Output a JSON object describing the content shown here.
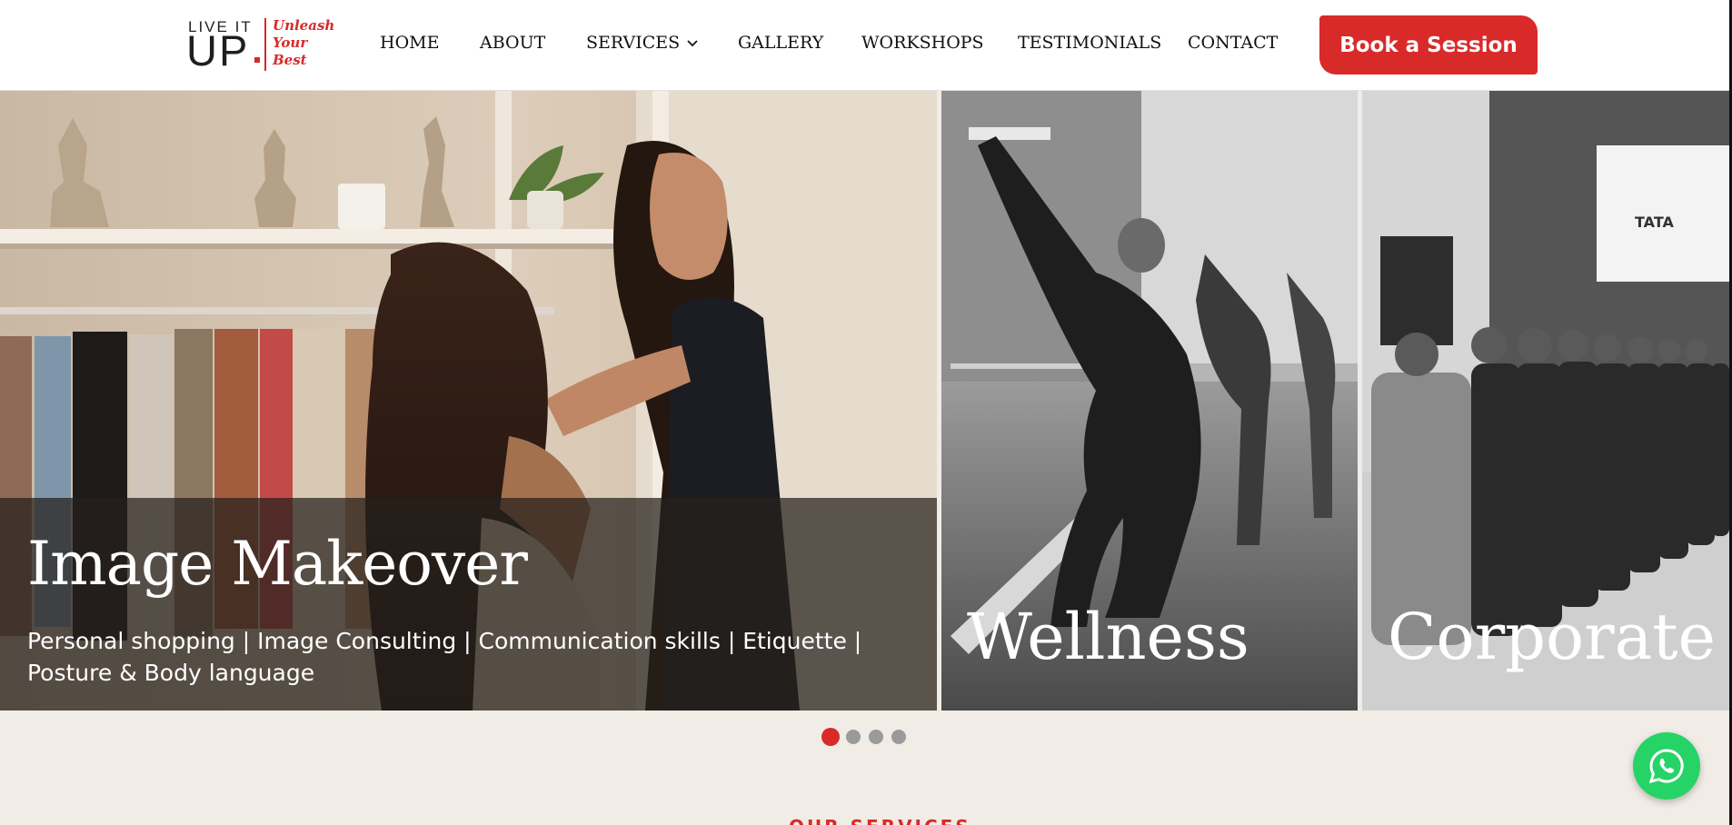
{
  "logo": {
    "line1": "LIVE IT",
    "line2": "UP",
    "tagline": [
      "Unleash",
      "Your",
      "Best"
    ]
  },
  "nav": {
    "items": [
      "HOME",
      "ABOUT",
      "SERVICES",
      "GALLERY",
      "WORKSHOPS",
      "TESTIMONIALS",
      "CONTACT"
    ],
    "services_has_dropdown": true
  },
  "cta": {
    "label": "Book a Session"
  },
  "slides": [
    {
      "title": "Image Makeover",
      "subtitle": "Personal shopping | Image Consulting | Communication skills | Etiquette | Posture & Body language",
      "style": "color photo"
    },
    {
      "title": "Wellness",
      "style": "grayscale photo"
    },
    {
      "title": "Corporate Tr",
      "style": "grayscale photo"
    }
  ],
  "carousel": {
    "dot_count": 4,
    "active_index": 0
  },
  "section_peek": {
    "text": "OUR SERVICES"
  },
  "colors": {
    "brand_red": "#d92a2a",
    "page_bg": "#f1ece6",
    "whatsapp_green": "#25d366"
  },
  "icons": {
    "services_dropdown": "chevron-down-icon",
    "floating_button": "whatsapp-icon"
  }
}
